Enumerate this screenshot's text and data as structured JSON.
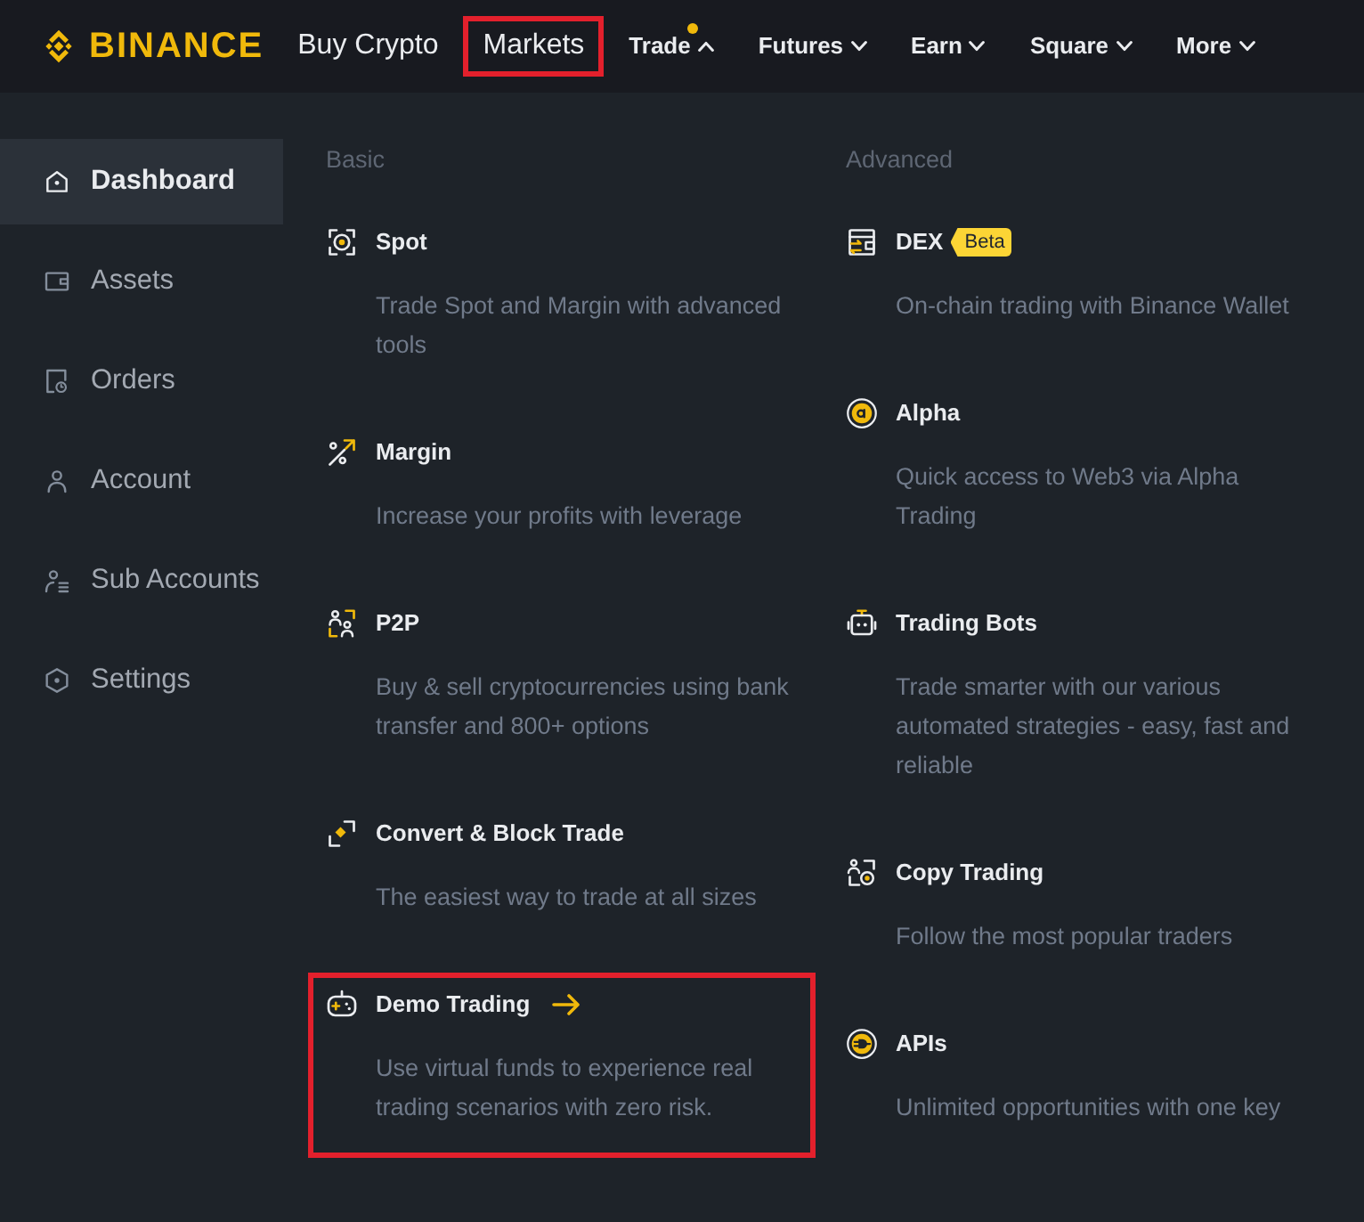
{
  "brand": {
    "name": "BINANCE"
  },
  "nav": {
    "items": [
      {
        "label": "Buy Crypto",
        "kind": "link",
        "annotated": false
      },
      {
        "label": "Markets",
        "kind": "link",
        "annotated": true
      },
      {
        "label": "Trade",
        "kind": "dropdown",
        "expanded": true,
        "dot": true,
        "annotated": false
      },
      {
        "label": "Futures",
        "kind": "dropdown",
        "expanded": false,
        "dot": false,
        "annotated": false
      },
      {
        "label": "Earn",
        "kind": "dropdown",
        "expanded": false,
        "dot": false,
        "annotated": false
      },
      {
        "label": "Square",
        "kind": "dropdown",
        "expanded": false,
        "dot": false,
        "annotated": false
      },
      {
        "label": "More",
        "kind": "dropdown",
        "expanded": false,
        "dot": false,
        "annotated": false
      }
    ]
  },
  "sidebar": {
    "items": [
      {
        "label": "Dashboard",
        "selected": true
      },
      {
        "label": "Assets",
        "selected": false
      },
      {
        "label": "Orders",
        "selected": false
      },
      {
        "label": "Account",
        "selected": false
      },
      {
        "label": "Sub Accounts",
        "selected": false
      },
      {
        "label": "Settings",
        "selected": false
      }
    ]
  },
  "menu": {
    "columns": [
      {
        "heading": "Basic",
        "items": [
          {
            "title": "Spot",
            "description": "Trade Spot and Margin with advanced tools",
            "arrow": false,
            "annotated": false
          },
          {
            "title": "Margin",
            "description": "Increase your profits with leverage",
            "arrow": false,
            "annotated": false
          },
          {
            "title": "P2P",
            "description": "Buy & sell cryptocurrencies using bank transfer and 800+ options",
            "arrow": false,
            "annotated": false
          },
          {
            "title": "Convert & Block Trade",
            "description": "The easiest way to trade at all sizes",
            "arrow": false,
            "annotated": false
          },
          {
            "title": "Demo Trading",
            "description": "Use virtual funds to experience real trading scenarios with zero risk.",
            "arrow": true,
            "annotated": true
          }
        ]
      },
      {
        "heading": "Advanced",
        "items": [
          {
            "title": "DEX",
            "badge": "Beta",
            "description": "On-chain trading with Binance Wallet",
            "arrow": false,
            "annotated": false
          },
          {
            "title": "Alpha",
            "description": "Quick access to Web3 via Alpha Trading",
            "arrow": false,
            "annotated": false
          },
          {
            "title": "Trading Bots",
            "description": "Trade smarter with our various automated strategies - easy, fast and reliable",
            "arrow": false,
            "annotated": false
          },
          {
            "title": "Copy Trading",
            "description": "Follow the most popular traders",
            "arrow": false,
            "annotated": false
          },
          {
            "title": "APIs",
            "description": "Unlimited opportunities with one key",
            "arrow": false,
            "annotated": false
          }
        ]
      }
    ]
  }
}
